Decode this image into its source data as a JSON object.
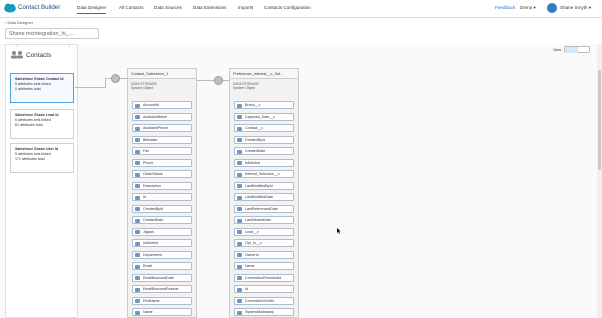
{
  "app": {
    "brand": "Contact Builder",
    "logo_icon": "salesforce-cloud-icon"
  },
  "nav": {
    "tabs": [
      "Data Designer",
      "All Contacts",
      "Data Sources",
      "Data Extensions",
      "Imports",
      "Contacts Configuration"
    ],
    "active_tab": "Data Designer",
    "feedback": "Feedback",
    "demo": "Demo",
    "user": "Shane Smyth"
  },
  "breadcrumb": "Data Designer",
  "page_title": "Shane mcintegration_hi_...",
  "view_label": "View",
  "contacts": {
    "title": "Contacts",
    "cards": [
      {
        "name": "Salesforce Shane Contact Id",
        "line1": "5 attributes sets linked",
        "line2": "0 attributes total"
      },
      {
        "name": "Salesforce Shane Lead Id",
        "line1": "5 attributes sets linked",
        "line2": "61 attributes total"
      },
      {
        "name": "Salesforce Shane User Id",
        "line1": "5 attributes sets linked",
        "line2": "171 attributes total"
      }
    ]
  },
  "objects": [
    {
      "title": "Contact_Salesforce_1",
      "storage": "DATA STORAGE",
      "type": "System Object",
      "fields": [
        "AccountId",
        "AssistantName",
        "AssistantPhone",
        "Birthdate",
        "Fax",
        "Phone",
        "CleanStatus",
        "Description",
        "Id",
        "CreatedById",
        "CreatedDate",
        "Jigsaw",
        "IsDeleted",
        "Department",
        "Email",
        "EmailBouncedDate",
        "EmailBouncedReason",
        "FirstName",
        "Name"
      ]
    },
    {
      "title": "Preference_Interest__c_Sal...",
      "storage": "DATA STORAGE",
      "type": "System Object",
      "fields": [
        "Brand__c",
        "Captured_Date__c",
        "Contact__c",
        "CreatedById",
        "CreatedDate",
        "IsDeleted",
        "Interest_Selection__c",
        "LastModifiedById",
        "LastModifiedDate",
        "LastReferencedDate",
        "LastViewedDate",
        "Lead__c",
        "Opt_In__c",
        "OwnerId",
        "Name",
        "ConnectionReceivedId",
        "Id",
        "ConnectionSentId",
        "SystemModstamp"
      ]
    }
  ]
}
